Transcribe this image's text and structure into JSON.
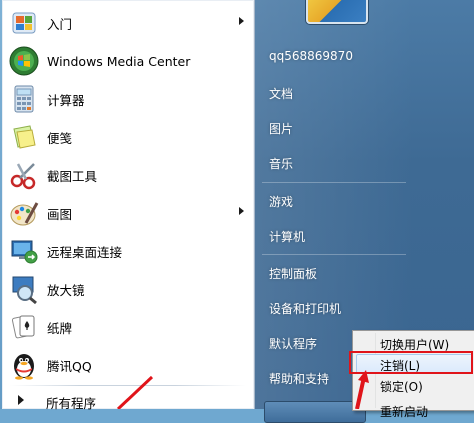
{
  "left_programs": [
    {
      "label": "入门",
      "icon": "getting-started-icon",
      "submenu": true
    },
    {
      "label": "Windows Media Center",
      "icon": "media-center-icon",
      "submenu": false
    },
    {
      "label": "计算器",
      "icon": "calculator-icon",
      "submenu": false
    },
    {
      "label": "便笺",
      "icon": "sticky-notes-icon",
      "submenu": false
    },
    {
      "label": "截图工具",
      "icon": "snipping-tool-icon",
      "submenu": false
    },
    {
      "label": "画图",
      "icon": "paint-icon",
      "submenu": true
    },
    {
      "label": "远程桌面连接",
      "icon": "remote-desktop-icon",
      "submenu": false
    },
    {
      "label": "放大镜",
      "icon": "magnifier-icon",
      "submenu": false
    },
    {
      "label": "纸牌",
      "icon": "solitaire-icon",
      "submenu": false
    },
    {
      "label": "腾讯QQ",
      "icon": "qq-penguin-icon",
      "submenu": false
    }
  ],
  "all_programs_label": "所有程序",
  "right_pane": {
    "username": "qq568869870",
    "items": [
      "文档",
      "图片",
      "音乐",
      "游戏",
      "计算机",
      "控制面板",
      "设备和打印机",
      "默认程序",
      "帮助和支持"
    ]
  },
  "context_menu": {
    "items": [
      {
        "label": "切换用户(W)"
      },
      {
        "label": "注销(L)"
      },
      {
        "label": "锁定(O)"
      },
      {
        "label": "重新启动"
      }
    ],
    "highlighted_index": 1
  },
  "colors": {
    "highlight_box": "#e0141a",
    "right_pane": "#3e6a94"
  }
}
